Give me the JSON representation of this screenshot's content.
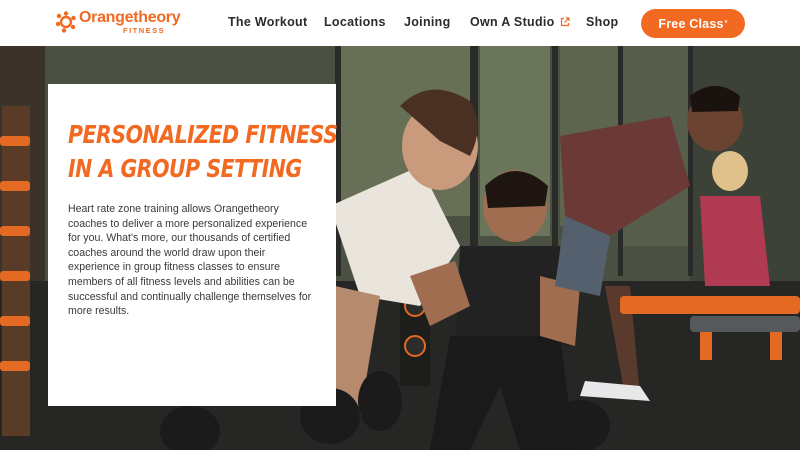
{
  "brand": {
    "name": "Orangetheory",
    "sub": "FITNESS",
    "accent": "#f26922"
  },
  "nav": {
    "items": [
      {
        "label": "The Workout"
      },
      {
        "label": "Locations"
      },
      {
        "label": "Joining"
      },
      {
        "label": "Own A Studio",
        "icon": "external-link-icon"
      },
      {
        "label": "Shop"
      }
    ],
    "cta": {
      "label": "Free Class",
      "sup": "*"
    }
  },
  "hero": {
    "image": "group-fitness-class-photo"
  },
  "card": {
    "title": "Personalized Fitness in a Group Setting",
    "body": "Heart rate zone training allows Orangetheory coaches to deliver a more personalized experience for you. What's more, our thousands of certified coaches around the world draw upon their experience in group fitness classes to ensure members of all fitness levels and abilities can be successful and continually challenge themselves for more results."
  }
}
